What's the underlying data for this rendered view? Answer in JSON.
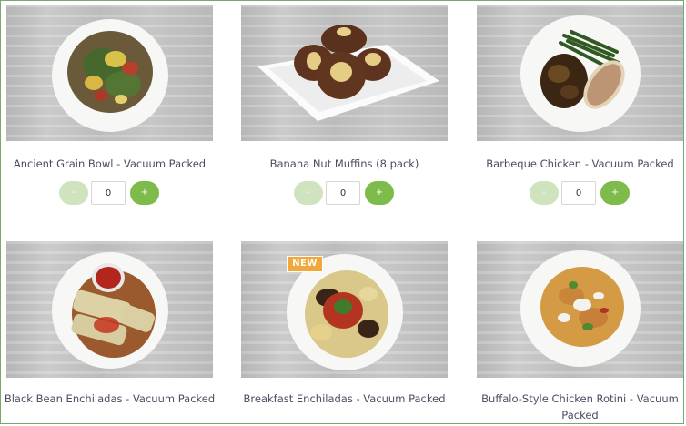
{
  "products": [
    {
      "name": "Ancient Grain Bowl - Vacuum Packed",
      "quantity": "0",
      "minus": "-",
      "plus": "+"
    },
    {
      "name": "Banana Nut Muffins (8 pack)",
      "quantity": "0",
      "minus": "-",
      "plus": "+"
    },
    {
      "name": "Barbeque Chicken - Vacuum Packed",
      "quantity": "0",
      "minus": "-",
      "plus": "+"
    },
    {
      "name": "Black Bean Enchiladas - Vacuum Packed"
    },
    {
      "name": "Breakfast Enchiladas - Vacuum Packed",
      "badge": "NEW"
    },
    {
      "name": "Buffalo-Style Chicken Rotini - Vacuum Packed"
    }
  ],
  "colors": {
    "plus_button": "#7dbb4a",
    "minus_button": "#cfe4be",
    "badge": "#f0a83a",
    "product_name_text": "#4a4d63",
    "frame_border": "#7aa86b"
  }
}
